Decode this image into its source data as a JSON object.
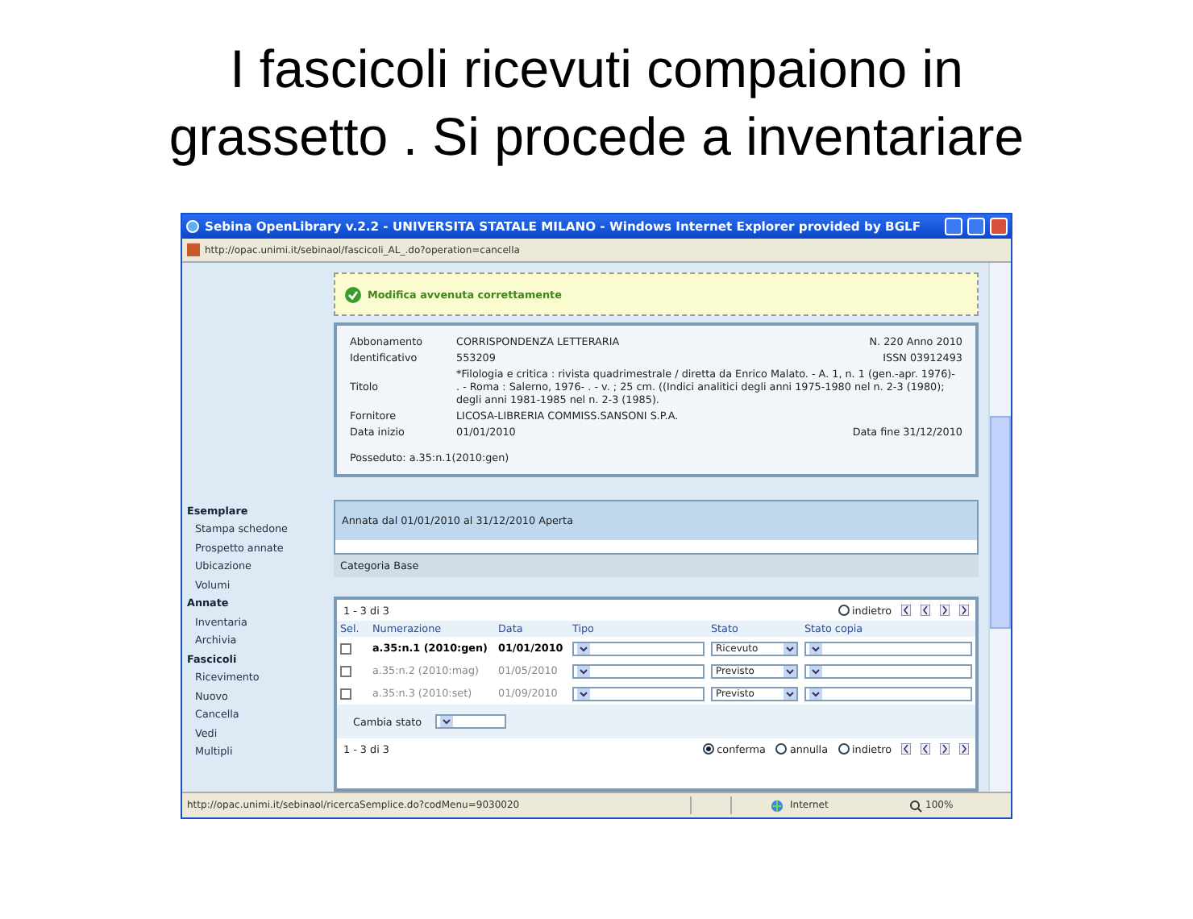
{
  "slide_title": "I fascicoli ricevuti compaiono in grassetto . Si procede a inventariare",
  "window": {
    "title": "Sebina OpenLibrary v.2.2 - UNIVERSITA STATALE MILANO - Windows Internet Explorer provided by BGLF",
    "address": "http://opac.unimi.it/sebinaol/fascicoli_AL_.do?operation=cancella"
  },
  "message": "Modifica avvenuta correttamente",
  "record": [
    {
      "label": "Abbonamento",
      "value": "CORRISPONDENZA LETTERARIA",
      "extra": "N. 220 Anno 2010"
    },
    {
      "label": "Identificativo",
      "value": "553209",
      "extra": "ISSN 03912493"
    },
    {
      "label": "Titolo",
      "value": "*Filologia e critica : rivista quadrimestrale / diretta da Enrico Malato. - A. 1, n. 1 (gen.-apr. 1976)- . - Roma : Salerno, 1976- . - v. ; 25 cm. ((Indici analitici degli anni 1975-1980 nel n. 2-3 (1980); degli anni 1981-1985 nel n. 2-3 (1985)."
    },
    {
      "label": "Fornitore",
      "value": "LICOSA-LIBRERIA COMMISS.SANSONI S.P.A."
    },
    {
      "label": "Data inizio",
      "value": "01/01/2010",
      "extra": "Data fine 31/12/2010"
    }
  ],
  "posseduto": "Posseduto: a.35:n.1(2010:gen)",
  "sidebar": [
    {
      "label": "Esemplare",
      "children": [
        {
          "label": "Stampa schedone"
        },
        {
          "label": "Prospetto annate"
        },
        {
          "label": "Ubicazione"
        },
        {
          "label": "Volumi"
        }
      ]
    },
    {
      "label": "Annate",
      "children": [
        {
          "label": "Inventaria"
        },
        {
          "label": "Archivia"
        }
      ]
    },
    {
      "label": "Fascicoli",
      "children": [
        {
          "label": "Ricevimento"
        },
        {
          "label": "Nuovo"
        },
        {
          "label": "Cancella"
        },
        {
          "label": "Vedi"
        },
        {
          "label": "Multipli"
        }
      ]
    }
  ],
  "annata": "Annata dal 01/01/2010 al 31/12/2010 Aperta",
  "categoria": "Categoria Base",
  "table": {
    "pager": "1 - 3 di 3",
    "top_radios": [
      {
        "label": "indietro",
        "selected": false
      }
    ],
    "columns": [
      "Sel.",
      "Numerazione",
      "Data",
      "Tipo",
      "Stato",
      "Stato copia"
    ],
    "rows": [
      {
        "numerazione": "a.35:n.1 (2010:gen)",
        "data": "01/01/2010",
        "stato": "Ricevuto",
        "bold": true,
        "checked": false
      },
      {
        "numerazione": "a.35:n.2 (2010:mag)",
        "data": "01/05/2010",
        "stato": "Previsto",
        "bold": false,
        "checked": false
      },
      {
        "numerazione": "a.35:n.3 (2010:set)",
        "data": "01/09/2010",
        "stato": "Previsto",
        "bold": false,
        "checked": false
      }
    ],
    "cambia_stato": "Cambia stato",
    "bottom_pager": "1 - 3 di 3",
    "bottom_radios": [
      {
        "label": "conferma",
        "selected": true
      },
      {
        "label": "annulla",
        "selected": false
      },
      {
        "label": "indietro",
        "selected": false
      }
    ]
  },
  "status_bar": {
    "url": "http://opac.unimi.it/sebinaol/ricercaSemplice.do?codMenu=9030020",
    "zone": "Internet",
    "zoom": "100%"
  }
}
